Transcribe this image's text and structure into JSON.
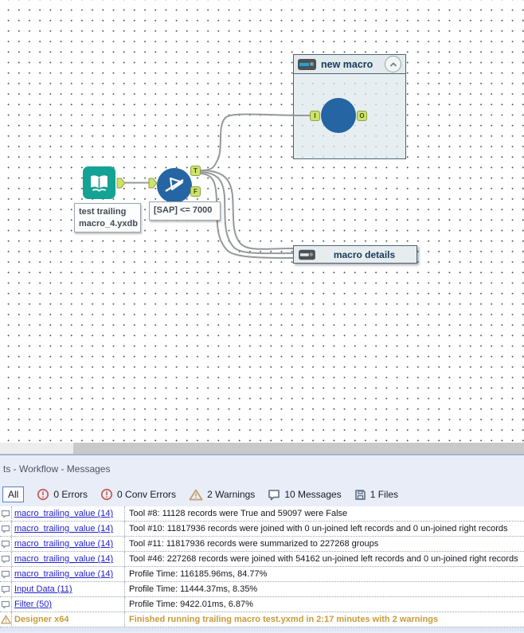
{
  "canvas": {
    "containers": {
      "macro": {
        "title": "new macro"
      },
      "details": {
        "title": "macro details"
      }
    },
    "annotations": {
      "input": "test trailing\nmacro_4.yxdb",
      "filter": "[SAP] <= 7000"
    },
    "anchors": {
      "input_label": "I",
      "output_label": "O",
      "true_label": "T",
      "false_label": "F"
    }
  },
  "panel": {
    "title": "ts - Workflow - Messages",
    "toolbar": {
      "all": "All",
      "errors": "0 Errors",
      "conv_errors": "0 Conv Errors",
      "warnings": "2 Warnings",
      "messages": "10 Messages",
      "files": "1 Files"
    },
    "rows": [
      {
        "kind": "message",
        "source": "macro_trailing_value (14)",
        "text": "Tool #8: 11128 records were True and 59097 were False"
      },
      {
        "kind": "message",
        "source": "macro_trailing_value (14)",
        "text": "Tool #10: 11817936 records were joined with 0 un-joined left records and 0 un-joined right records"
      },
      {
        "kind": "message",
        "source": "macro_trailing_value (14)",
        "text": "Tool #11: 11817936 records were summarized to 227268 groups"
      },
      {
        "kind": "message",
        "source": "macro_trailing_value (14)",
        "text": "Tool #46: 227268 records were joined with 54162 un-joined left records and 0 un-joined right records"
      },
      {
        "kind": "message",
        "source": "macro_trailing_value (14)",
        "text": "Profile Time: 116185.96ms, 84.77%"
      },
      {
        "kind": "message",
        "source": "Input Data (11)",
        "text": "Profile Time: 11444.37ms, 8.35%"
      },
      {
        "kind": "message",
        "source": "Filter (50)",
        "text": "Profile Time: 9422.01ms, 6.87%"
      },
      {
        "kind": "warning",
        "source": "Designer x64",
        "text": "Finished running trailing macro test.yxmd in 2:17 minutes with 2 warnings"
      }
    ]
  },
  "colors": {
    "tool_blue": "#2565a3",
    "tool_teal": "#14a295",
    "anchor_green": "#cde26b",
    "wire_grey": "#95999c",
    "link_blue": "#2222cc",
    "warning_gold": "#c89b3c",
    "error_red": "#c4615c",
    "panel_bg": "#e9edf8",
    "container_border": "#4d6572"
  }
}
